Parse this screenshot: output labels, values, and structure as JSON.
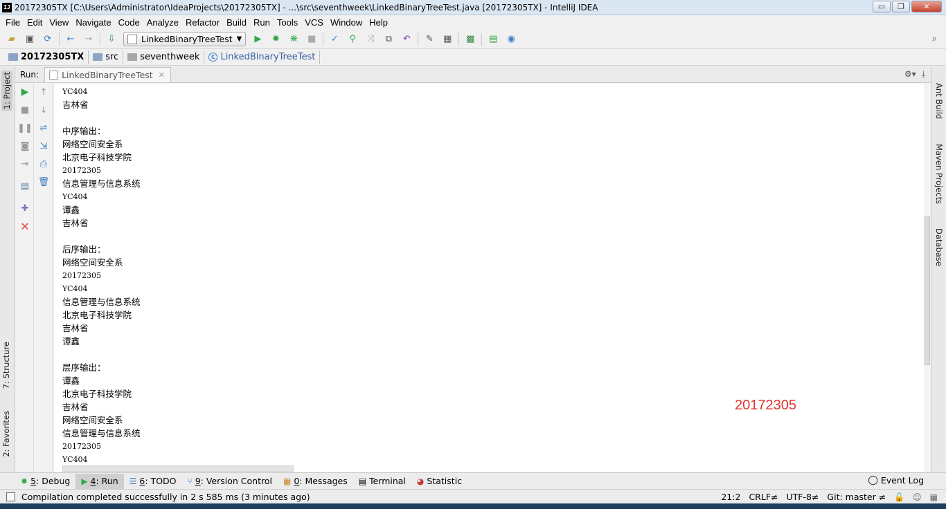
{
  "window": {
    "app_icon_text": "IJ",
    "title": "20172305TX [C:\\Users\\Administrator\\IdeaProjects\\20172305TX] - ...\\src\\seventhweek\\LinkedBinaryTreeTest.java [20172305TX] - IntelliJ IDEA",
    "controls": {
      "minimize": "▭",
      "maximize": "❐",
      "close": "✕"
    }
  },
  "menu": [
    {
      "label": "File"
    },
    {
      "label": "Edit"
    },
    {
      "label": "View"
    },
    {
      "label": "Navigate"
    },
    {
      "label": "Code"
    },
    {
      "label": "Analyze"
    },
    {
      "label": "Refactor"
    },
    {
      "label": "Build"
    },
    {
      "label": "Run"
    },
    {
      "label": "Tools"
    },
    {
      "label": "VCS"
    },
    {
      "label": "Window"
    },
    {
      "label": "Help"
    }
  ],
  "toolbar": {
    "run_config": "LinkedBinaryTreeTest"
  },
  "breadcrumbs": {
    "project": "20172305TX",
    "src": "src",
    "package": "seventhweek",
    "class_icon": "C",
    "class": "LinkedBinaryTreeTest"
  },
  "left_tabs": {
    "project": "1: Project",
    "structure": "7: Structure",
    "favorites": "2: Favorites"
  },
  "right_tabs": {
    "ant": "Ant Build",
    "maven": "Maven Projects",
    "database": "Database"
  },
  "run_panel": {
    "label": "Run:",
    "tab": "LinkedBinaryTreeTest"
  },
  "console": {
    "lines": [
      "YC404",
      "吉林省",
      "",
      "中序输出：",
      "网络空间安全系",
      "北京电子科技学院",
      "20172305",
      "信息管理与信息系统",
      "YC404",
      "谭鑫",
      "吉林省",
      "",
      "后序输出：",
      "网络空间安全系",
      "20172305",
      "YC404",
      "信息管理与信息系统",
      "北京电子科技学院",
      "吉林省",
      "谭鑫",
      "",
      "层序输出：",
      "谭鑫",
      "北京电子科技学院",
      "吉林省",
      "网络空间安全系",
      "信息管理与信息系统",
      "20172305",
      "YC404"
    ],
    "watermark": "20172305"
  },
  "bottom_tabs": {
    "debug_num": "5",
    "debug_label": ": Debug",
    "run_num": "4",
    "run_label": ": Run",
    "todo_num": "6",
    "todo_label": ": TODO",
    "vcs_num": "9",
    "vcs_label": ": Version Control",
    "messages_num": "0",
    "messages_label": ": Messages",
    "terminal": "Terminal",
    "statistic": "Statistic",
    "event_log": "Event Log"
  },
  "status": {
    "message": "Compilation completed successfully in 2 s 585 ms (3 minutes ago)",
    "position": "21:2",
    "line_sep": "CRLF≠",
    "encoding": "UTF-8≠",
    "git": "Git: master ≠"
  }
}
